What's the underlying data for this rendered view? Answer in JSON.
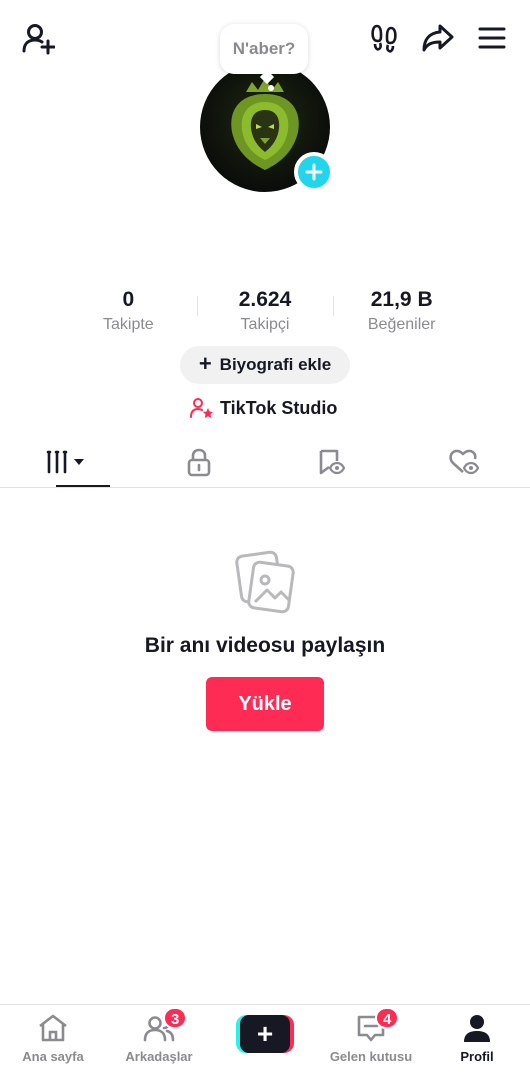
{
  "header": {
    "add_friend_icon": "person-plus-icon",
    "footprints_icon": "footprints-icon",
    "share_icon": "share-arrow-icon",
    "menu_icon": "hamburger-menu-icon"
  },
  "profile": {
    "status_bubble": "N'aber?",
    "avatar_description_icon": "lion-avatar",
    "avatar_add_icon": "plus-icon"
  },
  "stats": [
    {
      "value": "0",
      "label": "Takipte"
    },
    {
      "value": "2.624",
      "label": "Takipçi"
    },
    {
      "value": "21,9 B",
      "label": "Beğeniler"
    }
  ],
  "bio_button": {
    "plus": "+",
    "label": "Biyografi ekle"
  },
  "studio_link": {
    "label": "TikTok Studio",
    "icon": "person-star-icon"
  },
  "tabs": [
    {
      "name": "videos-grid",
      "icon": "grid-bars-dropdown-icon",
      "active": true
    },
    {
      "name": "private",
      "icon": "lock-icon",
      "active": false
    },
    {
      "name": "saved",
      "icon": "bookmark-eye-icon",
      "active": false
    },
    {
      "name": "liked",
      "icon": "heart-eye-icon",
      "active": false
    }
  ],
  "empty_state": {
    "icon": "photos-icon",
    "title": "Bir anı videosu paylaşın",
    "button_label": "Yükle"
  },
  "bottom_nav": {
    "home": {
      "label": "Ana sayfa",
      "icon": "home-icon"
    },
    "friends": {
      "label": "Arkadaşlar",
      "icon": "friends-icon",
      "badge": "3"
    },
    "create": {
      "label": "+",
      "icon": "create-plus-icon"
    },
    "inbox": {
      "label": "Gelen kutusu",
      "icon": "inbox-icon",
      "badge": "4"
    },
    "profile": {
      "label": "Profil",
      "icon": "profile-icon"
    }
  },
  "colors": {
    "accent_red": "#fe2c55",
    "accent_cyan": "#25f4ee",
    "avatar_add_blue": "#20d5ec",
    "text_primary": "#161823",
    "text_secondary": "#8a8b91"
  }
}
